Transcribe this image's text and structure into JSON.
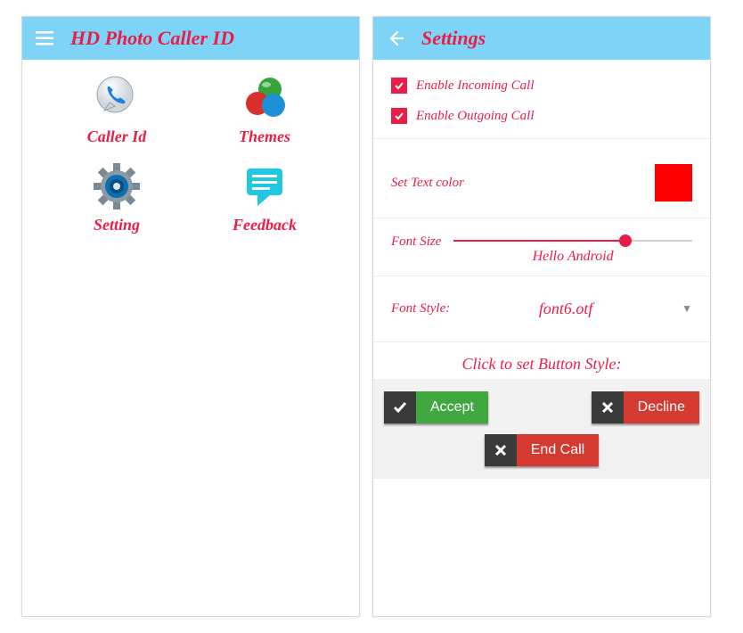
{
  "home": {
    "title": "HD Photo Caller ID",
    "items": [
      {
        "label": "Caller Id"
      },
      {
        "label": "Themes"
      },
      {
        "label": "Setting"
      },
      {
        "label": "Feedback"
      }
    ]
  },
  "settings": {
    "title": "Settings",
    "enable_incoming": "Enable Incoming Call",
    "enable_outgoing": "Enable Outgoing Call",
    "text_color_label": "Set Text color",
    "text_color_value": "#ff0000",
    "font_size_label": "Font Size",
    "font_size_percent": 72,
    "font_preview": "Hello Android",
    "font_style_label": "Font Style:",
    "font_style_value": "font6.otf",
    "button_style_header": "Click to set Button Style:",
    "buttons": {
      "accept": "Accept",
      "decline": "Decline",
      "endcall": "End Call"
    }
  }
}
